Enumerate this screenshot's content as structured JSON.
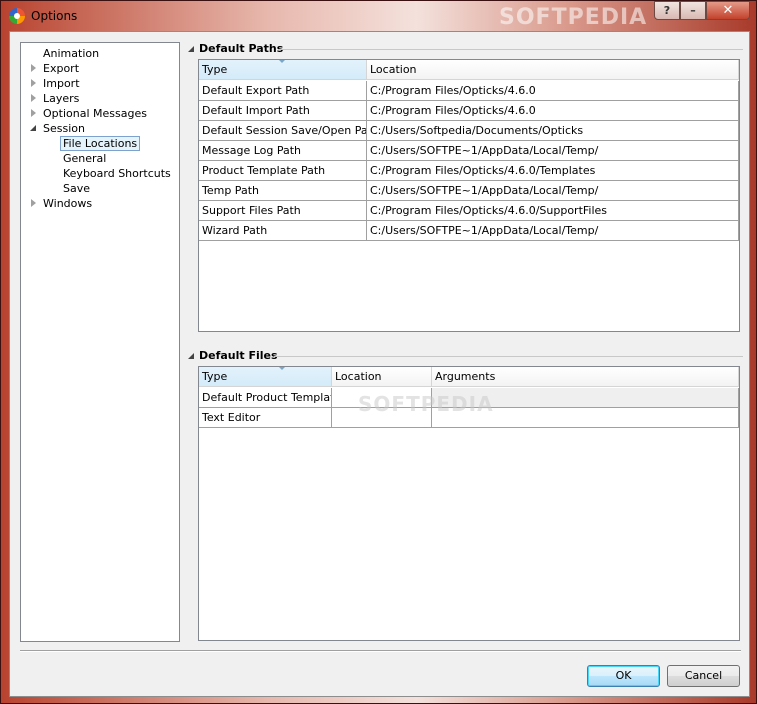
{
  "window": {
    "title": "Options",
    "watermark": "SOFTPEDIA",
    "help_button": "?",
    "minimize_button": "–",
    "close_button": "✕"
  },
  "tree": [
    {
      "label": "Animation",
      "expander": "none"
    },
    {
      "label": "Export",
      "expander": "collapsed"
    },
    {
      "label": "Import",
      "expander": "collapsed"
    },
    {
      "label": "Layers",
      "expander": "collapsed"
    },
    {
      "label": "Optional Messages",
      "expander": "collapsed"
    },
    {
      "label": "Session",
      "expander": "expanded"
    },
    {
      "label": "File Locations",
      "expander": "none",
      "child": true,
      "selected": true
    },
    {
      "label": "General",
      "expander": "none",
      "child": true
    },
    {
      "label": "Keyboard Shortcuts",
      "expander": "none",
      "child": true
    },
    {
      "label": "Save",
      "expander": "none",
      "child": true
    },
    {
      "label": "Windows",
      "expander": "collapsed"
    }
  ],
  "default_paths": {
    "heading": "Default Paths",
    "columns": [
      "Type",
      "Location"
    ],
    "rows": [
      [
        "Default Export Path",
        "C:/Program Files/Opticks/4.6.0"
      ],
      [
        "Default Import Path",
        "C:/Program Files/Opticks/4.6.0"
      ],
      [
        "Default Session Save/Open Path",
        "C:/Users/Softpedia/Documents/Opticks"
      ],
      [
        "Message Log Path",
        "C:/Users/SOFTPE~1/AppData/Local/Temp/"
      ],
      [
        "Product Template Path",
        "C:/Program Files/Opticks/4.6.0/Templates"
      ],
      [
        "Temp Path",
        "C:/Users/SOFTPE~1/AppData/Local/Temp/"
      ],
      [
        "Support Files Path",
        "C:/Program Files/Opticks/4.6.0/SupportFiles"
      ],
      [
        "Wizard Path",
        "C:/Users/SOFTPE~1/AppData/Local/Temp/"
      ]
    ]
  },
  "default_files": {
    "heading": "Default Files",
    "watermark": "SOFTPEDIA",
    "columns": [
      "Type",
      "Location",
      "Arguments"
    ],
    "rows": [
      [
        "Default Product Template",
        "",
        ""
      ],
      [
        "Text Editor",
        "",
        ""
      ]
    ]
  },
  "buttons": {
    "ok": "OK",
    "cancel": "Cancel"
  },
  "colors": {
    "selection_bg": "#e5f3fb",
    "selection_border": "#7da2ce",
    "default_button_border": "#3c7fb1"
  }
}
